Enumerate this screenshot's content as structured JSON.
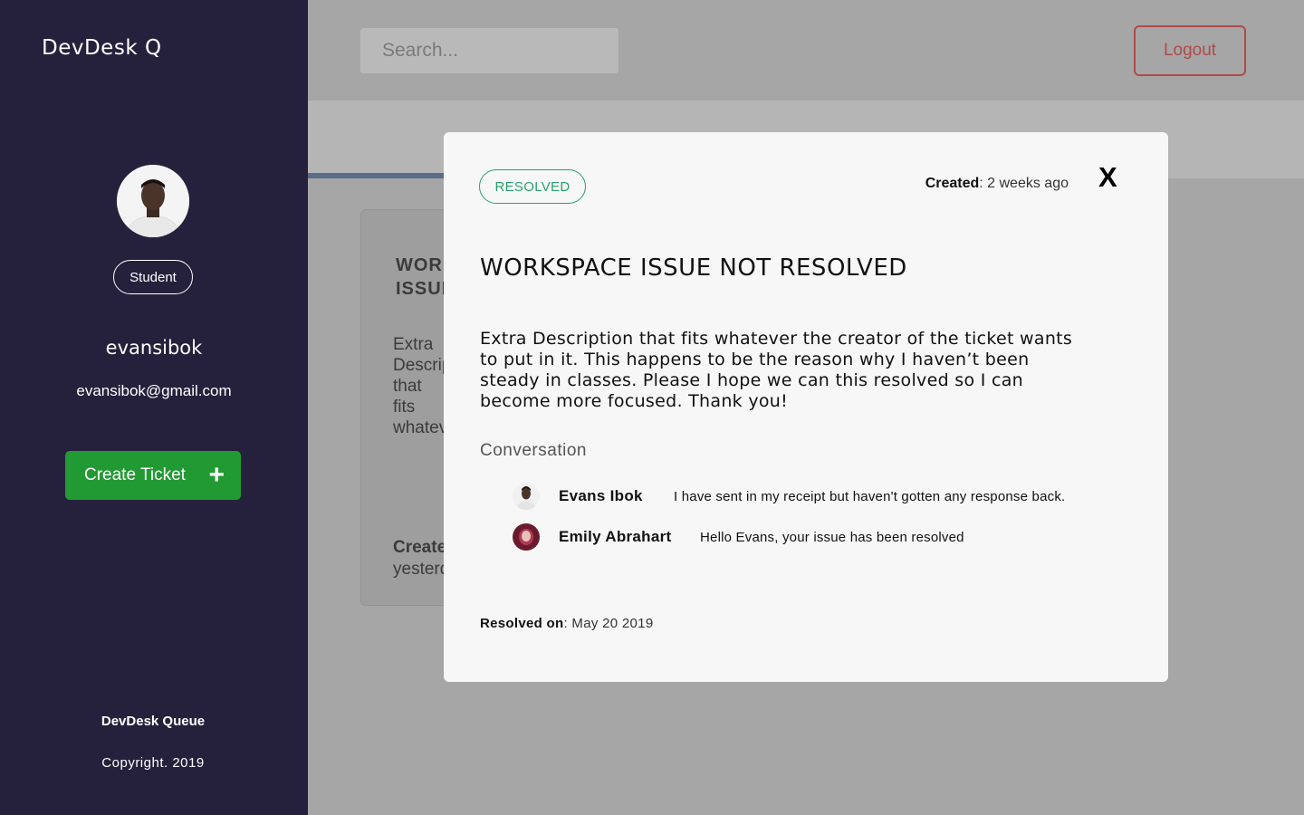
{
  "sidebar": {
    "brand": "DevDesk Q",
    "role": "Student",
    "username": "evansibok",
    "email": "evansibok@gmail.com",
    "create_ticket_label": "Create Ticket",
    "create_icon": "plus-icon",
    "footer_title": "DevDesk Queue",
    "footer_copyright": "Copyright. 2019"
  },
  "header": {
    "search_placeholder": "Search...",
    "logout_label": "Logout"
  },
  "background_card": {
    "title": "WORKSPACE ISSUE NOT RESOLVED",
    "description": "Extra Description that fits whatever the creator of the ticket wants to put in it. This s",
    "created_label": "Created",
    "created_value": "yesterday"
  },
  "modal": {
    "status": "RESOLVED",
    "created_label": "Created",
    "created_value": ": 2 weeks ago",
    "close_label": "X",
    "title": "WORKSPACE ISSUE NOT RESOLVED",
    "description": "Extra Description that fits whatever the creator of the ticket wants to put in it. This happens to be the reason why I haven’t been steady in classes. Please I hope we can this resolved so I can become more focused. Thank you!",
    "conversation_label": "Conversation",
    "messages": [
      {
        "author": "Evans Ibok",
        "text": "I have sent in my receipt but haven't gotten any response back."
      },
      {
        "author": "Emily Abrahart",
        "text": "Hello Evans, your issue has been resolved"
      }
    ],
    "resolved_label": "Resolved on",
    "resolved_value": ": May 20 2019"
  },
  "colors": {
    "sidebar_bg": "#25213c",
    "create_button": "#229a33",
    "resolved_green": "#2aa06e",
    "logout_red": "#b04a4a",
    "overlay": "#a6a6a6"
  }
}
